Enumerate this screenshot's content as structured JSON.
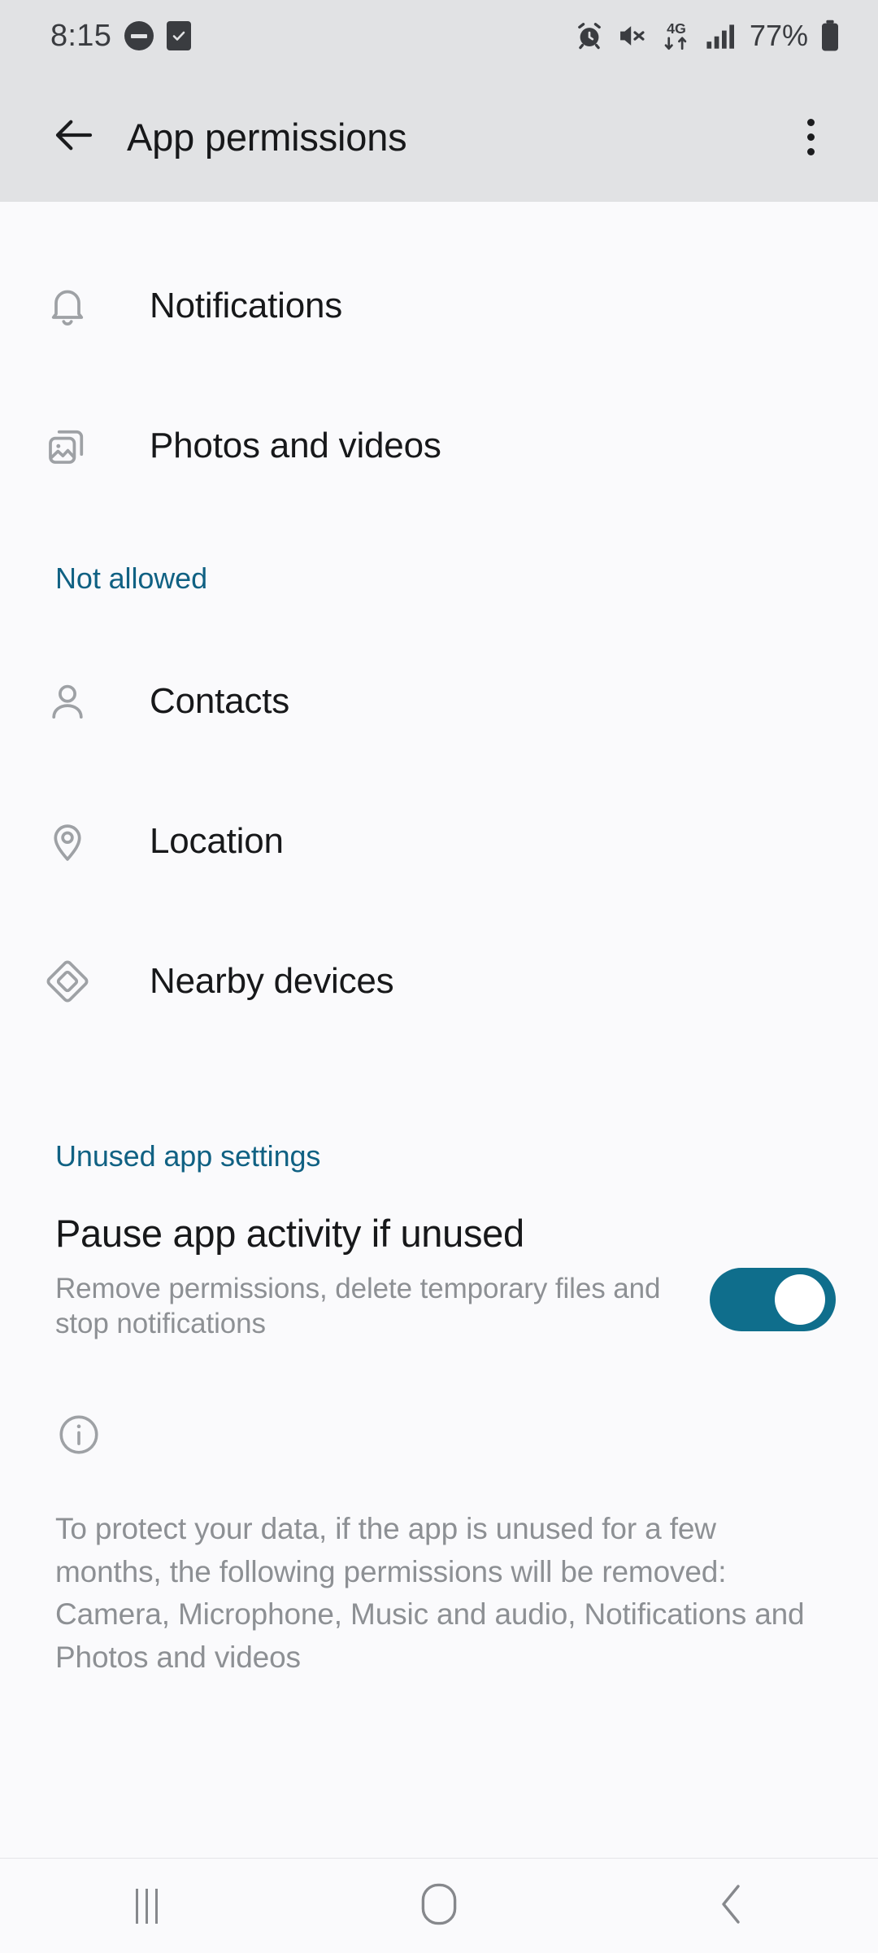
{
  "status_bar": {
    "time": "8:15",
    "battery_percent": "77%",
    "left_icons": [
      "do-not-disturb-icon",
      "checkbox-icon"
    ],
    "right_icons": [
      "alarm-icon",
      "mute-icon",
      "4g-data-icon",
      "signal-bars-icon",
      "battery-icon"
    ],
    "network_label": "4G"
  },
  "app_bar": {
    "title": "App permissions",
    "back_icon": "back-arrow-icon",
    "overflow_icon": "more-vertical-icon"
  },
  "allowed_permissions": [
    {
      "label": "Notifications",
      "icon": "bell-icon"
    },
    {
      "label": "Photos and videos",
      "icon": "photo-stack-icon"
    }
  ],
  "not_allowed_section": {
    "header": "Not allowed",
    "items": [
      {
        "label": "Contacts",
        "icon": "person-icon"
      },
      {
        "label": "Location",
        "icon": "location-pin-icon"
      },
      {
        "label": "Nearby devices",
        "icon": "nearby-devices-icon"
      }
    ]
  },
  "unused_section": {
    "header": "Unused app settings",
    "toggle_title": "Pause app activity if unused",
    "toggle_subtitle": "Remove permissions, delete temporary files and stop notifications",
    "toggle_on": true,
    "info_icon": "info-circle-icon",
    "footnote": "To protect your data, if the app is unused for a few months, the following permissions will be removed: Camera, Microphone, Music and audio, Notifications and Photos and videos"
  },
  "nav_bar": {
    "recents_icon": "recents-icon",
    "home_icon": "home-icon",
    "back_icon": "back-chevron-icon"
  },
  "colors": {
    "accent_teal": "#106183",
    "toggle_on": "#0F6E8C",
    "bar_background": "#E1E2E4",
    "page_background": "#FAFAFC",
    "primary_text": "#17181A",
    "secondary_text": "#8D9094",
    "icon_gray": "#9EA1A5"
  }
}
